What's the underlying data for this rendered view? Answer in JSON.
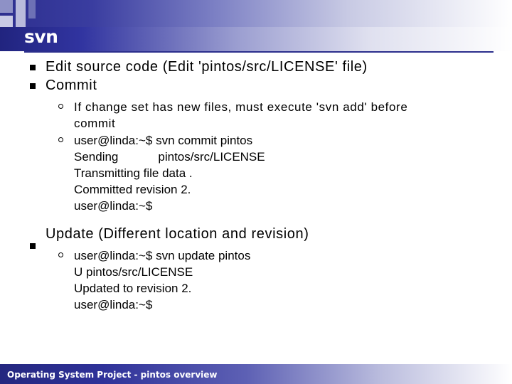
{
  "slide": {
    "title": "svn",
    "footer": "Operating System Project - pintos overview",
    "accent_dark": "#21247f",
    "accent_mid": "#5d60b4",
    "accent_light": "#b9bbdd"
  },
  "bullets": [
    {
      "text": "Edit source code (Edit 'pintos/src/LICENSE' file)",
      "sub": []
    },
    {
      "text": "Commit",
      "sub": [
        {
          "lines": [
            "If change set has new files, must execute 'svn add' before",
            "commit"
          ],
          "mono": false
        },
        {
          "lines": [
            "user@linda:~$ svn commit pintos",
            "Sending||||pintos/src/LICENSE",
            "Transmitting file data .",
            "Committed revision 2.",
            "user@linda:~$"
          ],
          "mono": true
        }
      ]
    },
    {
      "text": "Update (Different location and revision)",
      "sub": [
        {
          "lines": [
            "user@linda:~$ svn update pintos",
            "U  pintos/src/LICENSE",
            "Updated to revision 2.",
            "user@linda:~$"
          ],
          "mono": true
        }
      ]
    }
  ]
}
